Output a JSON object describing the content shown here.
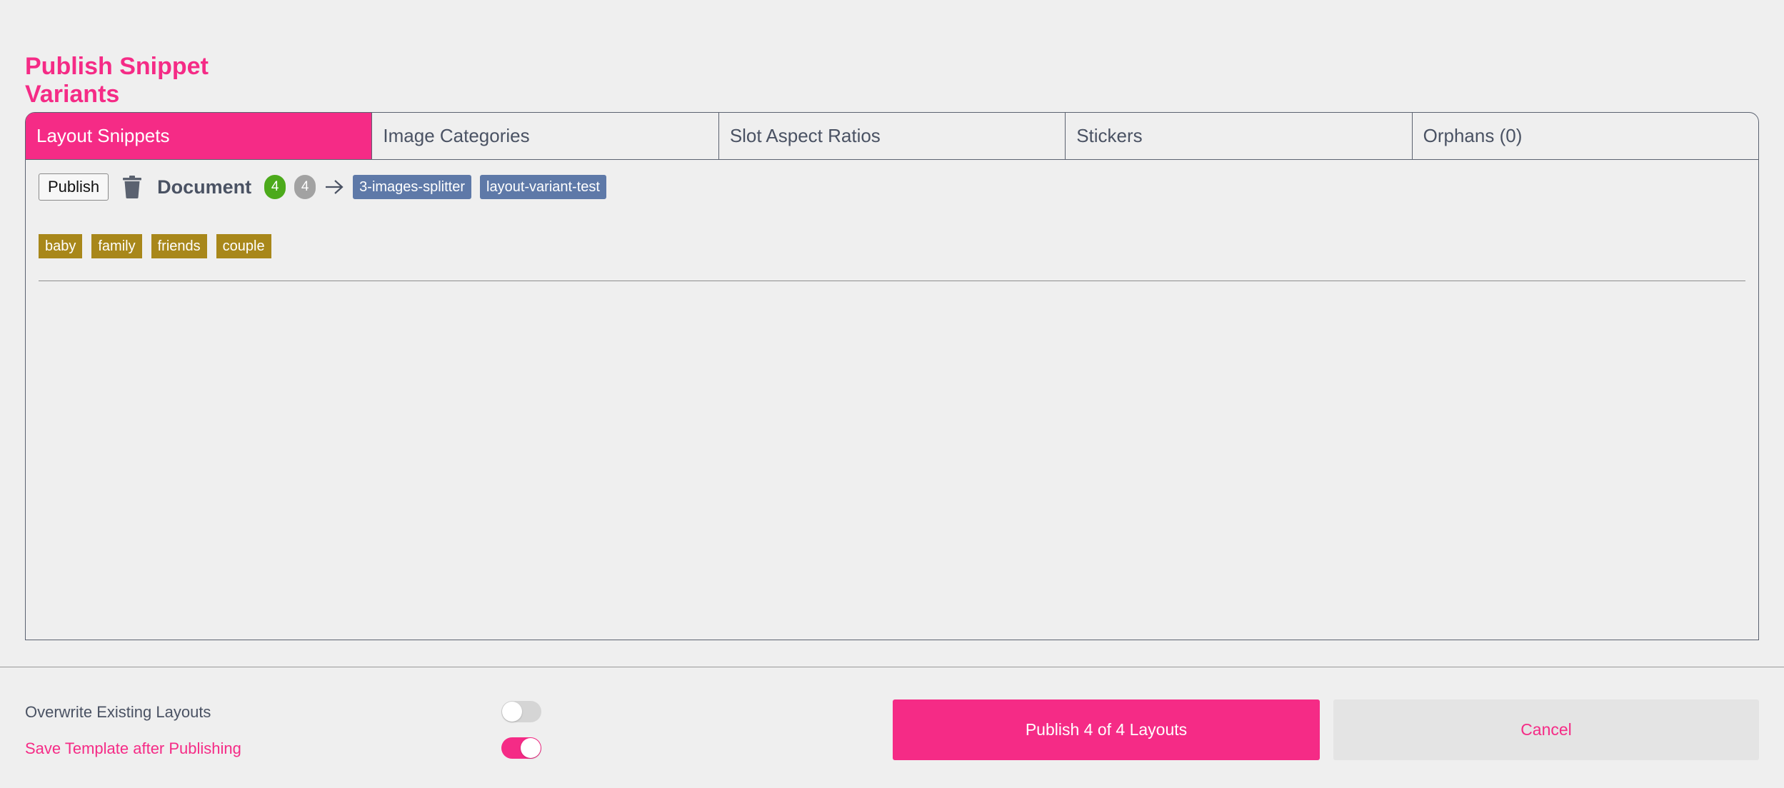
{
  "page": {
    "title": "Publish Snippet Variants"
  },
  "tabs": [
    {
      "label": "Layout Snippets",
      "active": true
    },
    {
      "label": "Image Categories",
      "active": false
    },
    {
      "label": "Slot Aspect Ratios",
      "active": false
    },
    {
      "label": "Stickers",
      "active": false
    },
    {
      "label": "Orphans (0)",
      "active": false
    }
  ],
  "snippet": {
    "publish_label": "Publish",
    "trash_icon": "trash-icon",
    "name": "Document",
    "count_published": "4",
    "count_total": "4",
    "arrow_icon": "arrow-right-icon",
    "targets": [
      "3-images-splitter",
      "layout-variant-test"
    ],
    "tags": [
      "baby",
      "family",
      "friends",
      "couple"
    ]
  },
  "options": {
    "overwrite_label": "Overwrite Existing Layouts",
    "overwrite_on": false,
    "save_template_label": "Save Template after Publishing",
    "save_template_on": true
  },
  "actions": {
    "publish_label": "Publish 4 of 4 Layouts",
    "cancel_label": "Cancel"
  },
  "colors": {
    "accent": "#f52b86",
    "count_green": "#4caa1b",
    "count_gray": "#a2a2a2",
    "target_chip": "#5e79a8",
    "tag": "#a8871a",
    "text": "#4a5263",
    "background": "#efefef"
  }
}
